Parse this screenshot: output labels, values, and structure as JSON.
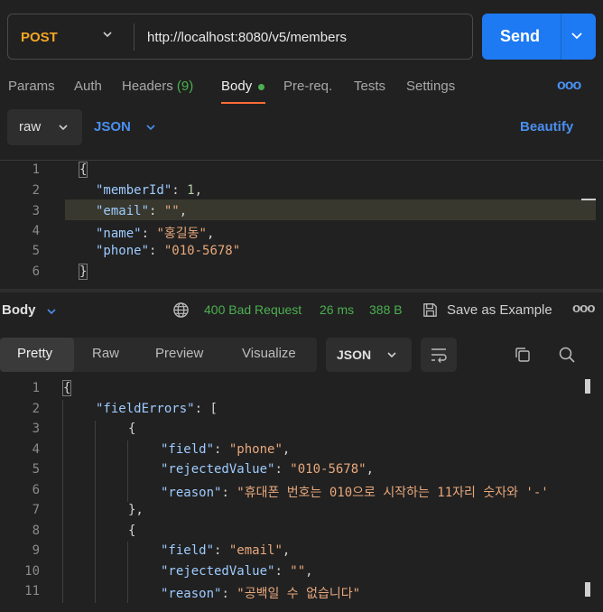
{
  "request": {
    "method": "POST",
    "url": "http://localhost:8080/v5/members",
    "send_label": "Send"
  },
  "tabs": {
    "params": "Params",
    "auth": "Auth",
    "headers": "Headers",
    "headers_count": "(9)",
    "body": "Body",
    "prereq": "Pre-req.",
    "tests": "Tests",
    "settings": "Settings",
    "more": "ooo"
  },
  "body_options": {
    "mode": "raw",
    "language": "JSON",
    "beautify": "Beautify"
  },
  "request_body": {
    "line_numbers": [
      "1",
      "2",
      "3",
      "4",
      "5",
      "6"
    ],
    "open": "{",
    "close": "}",
    "member_id_key": "\"memberId\"",
    "member_id_val": "1",
    "email_key": "\"email\"",
    "email_val": "\"\"",
    "name_key": "\"name\"",
    "name_val": "\"홍길동\"",
    "phone_key": "\"phone\"",
    "phone_val": "\"010-5678\""
  },
  "response_bar": {
    "label": "Body",
    "status": "400 Bad Request",
    "time": "26 ms",
    "size": "388 B",
    "save": "Save as Example",
    "more": "ooo"
  },
  "response_tabs": {
    "pretty": "Pretty",
    "raw": "Raw",
    "preview": "Preview",
    "visualize": "Visualize",
    "format": "JSON"
  },
  "response_body": {
    "line_numbers": [
      "1",
      "2",
      "3",
      "4",
      "5",
      "6",
      "7",
      "8",
      "9",
      "10",
      "11"
    ],
    "open": "{",
    "field_errors_key": "\"fieldErrors\"",
    "arr_open": "[",
    "obj_open": "{",
    "obj_close": "},",
    "field_key": "\"field\"",
    "rejected_key": "\"rejectedValue\"",
    "reason_key": "\"reason\"",
    "e1_field": "\"phone\"",
    "e1_rejected": "\"010-5678\"",
    "e1_reason": "\"휴대폰 번호는 010으로 시작하는 11자리 숫자와 '-'",
    "e2_field": "\"email\"",
    "e2_rejected": "\"\"",
    "e2_reason": "\"공백일 수 없습니다\""
  }
}
